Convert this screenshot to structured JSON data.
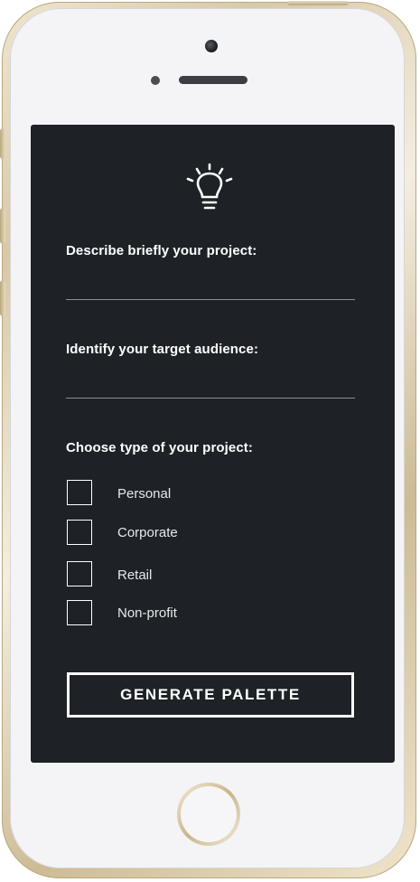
{
  "colors": {
    "screen_background": "#1e2226",
    "text": "#ffffff",
    "device_frame": "#d8c8a6"
  },
  "header": {
    "icon": "lightbulb-icon"
  },
  "form": {
    "project_description": {
      "label": "Describe briefly your project:",
      "value": ""
    },
    "target_audience": {
      "label": "Identify your target audience:",
      "value": ""
    },
    "project_type": {
      "label": "Choose type of your project:",
      "options": [
        {
          "label": "Personal",
          "checked": false
        },
        {
          "label": "Corporate",
          "checked": false
        },
        {
          "label": "Retail",
          "checked": false
        },
        {
          "label": "Non-profit",
          "checked": false
        }
      ]
    },
    "submit_label": "GENERATE PALETTE"
  }
}
